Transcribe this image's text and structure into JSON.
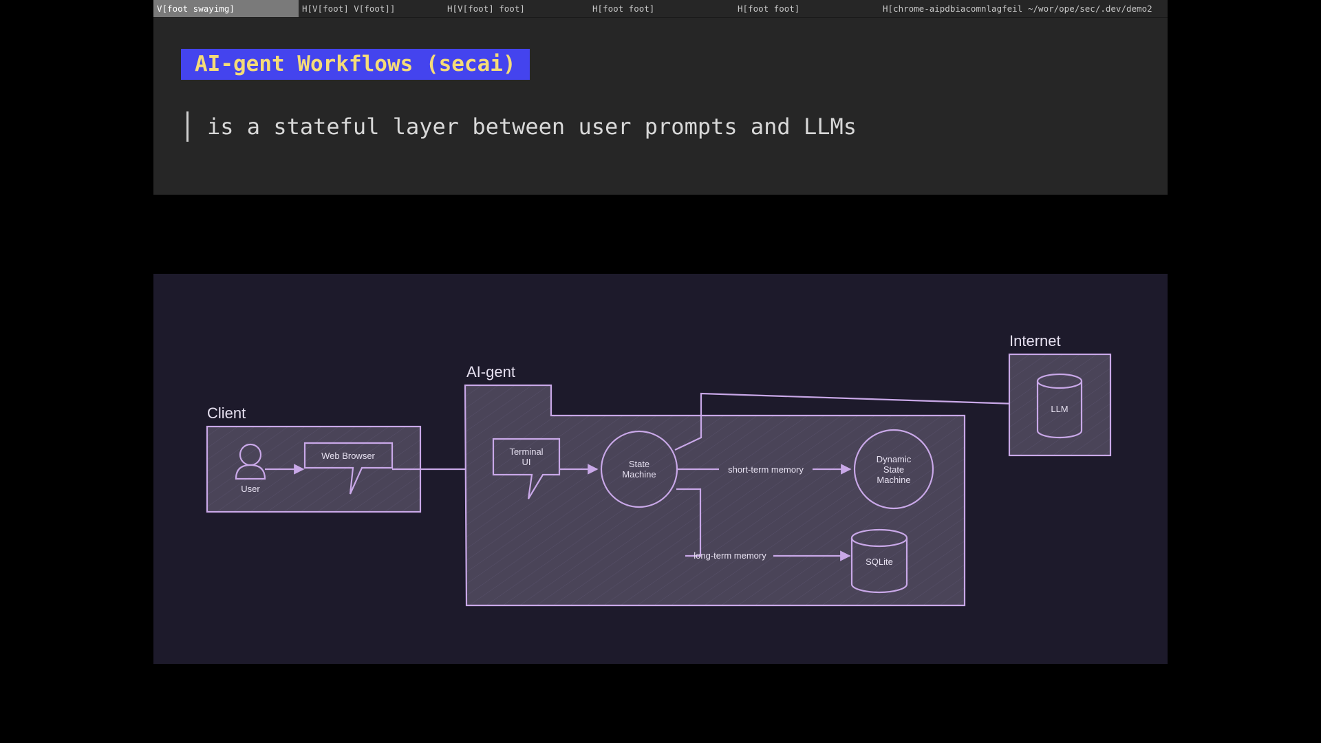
{
  "tabs": [
    {
      "label": "V[foot swayimg]",
      "active": true
    },
    {
      "label": "H[V[foot] V[foot]]",
      "active": false
    },
    {
      "label": "H[V[foot] foot]",
      "active": false
    },
    {
      "label": "H[foot foot]",
      "active": false
    },
    {
      "label": "H[foot foot]",
      "active": false
    },
    {
      "label": "H[chrome-aipdbiacomnlagfeil",
      "active": false
    },
    {
      "label": "~/wor/ope/sec/.dev/demo2",
      "active": false
    }
  ],
  "slide": {
    "title": "AI-gent Workflows (secai)",
    "quote": "is a stateful layer between user prompts and LLMs"
  },
  "diagram": {
    "groups": {
      "client": "Client",
      "aigent": "AI-gent",
      "internet": "Internet"
    },
    "nodes": {
      "user": "User",
      "web_browser": "Web Browser",
      "terminal_ui_1": "Terminal",
      "terminal_ui_2": "UI",
      "state_machine_1": "State",
      "state_machine_2": "Machine",
      "dynamic_1": "Dynamic",
      "dynamic_2": "State",
      "dynamic_3": "Machine",
      "sqlite": "SQLite",
      "llm": "LLM"
    },
    "edges": {
      "short_term": "short-term memory",
      "long_term": "long-term memory"
    }
  },
  "colors": {
    "title_bg": "#4444ee",
    "title_fg": "#f5dc78",
    "diagram_bg": "#1d1a2b",
    "diagram_stroke": "#c9a8e8"
  }
}
